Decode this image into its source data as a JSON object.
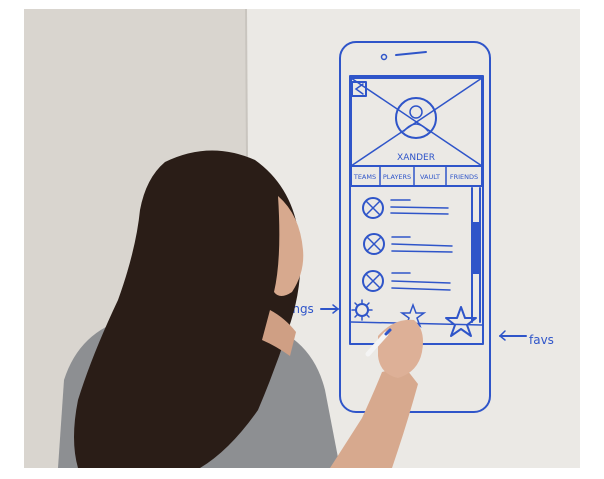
{
  "sketch": {
    "profile_name": "XANDER",
    "tabs": [
      {
        "label": "TEAMS"
      },
      {
        "label": "PLAYERS"
      },
      {
        "label": "VAULT"
      },
      {
        "label": "FRIENDS"
      }
    ],
    "annotations": {
      "left": "ings",
      "right": "favs"
    }
  },
  "colors": {
    "wall_left": "#d9d5cf",
    "wall_right": "#ebe9e5",
    "marker_ink": "#2f55c9",
    "hair": "#2a1d17",
    "shirt": "#8d8f92",
    "skin": "#d7a98e"
  },
  "icons": {
    "back": "back-arrow-icon",
    "avatar": "user-avatar-icon",
    "settings": "gear-icon",
    "favorites": "star-icon"
  }
}
